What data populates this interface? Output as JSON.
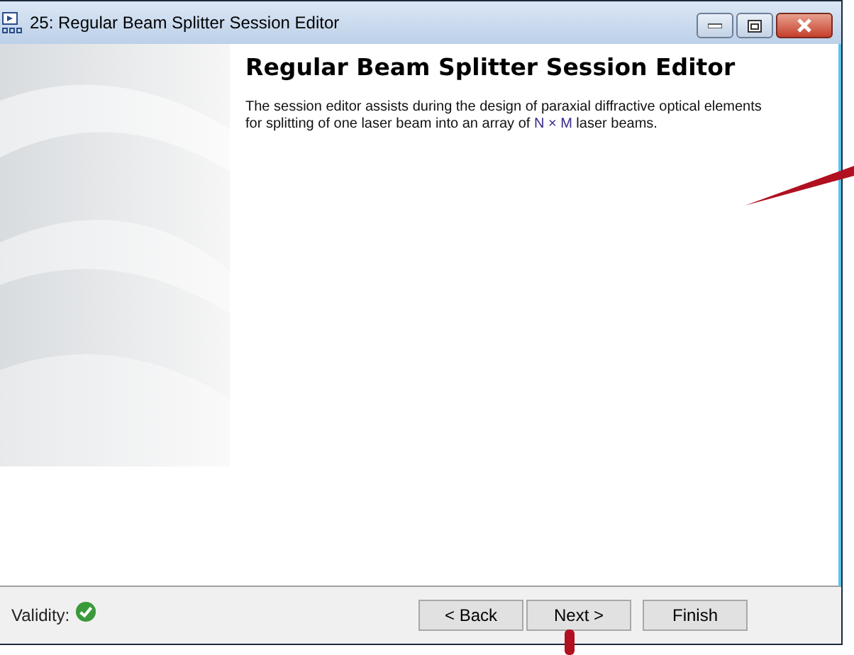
{
  "window": {
    "title": "25: Regular Beam Splitter Session Editor"
  },
  "heading": "Regular Beam Splitter Session Editor",
  "description": {
    "before": "The session editor assists during the design of paraxial diffractive optical elements for splitting of one laser beam into an array of ",
    "highlight": "N × M",
    "after": " laser beams."
  },
  "status": {
    "label": "Validity:",
    "valid": true
  },
  "buttons": [
    {
      "label": "< Back"
    },
    {
      "label": "Next >"
    },
    {
      "label": "Finish"
    }
  ]
}
